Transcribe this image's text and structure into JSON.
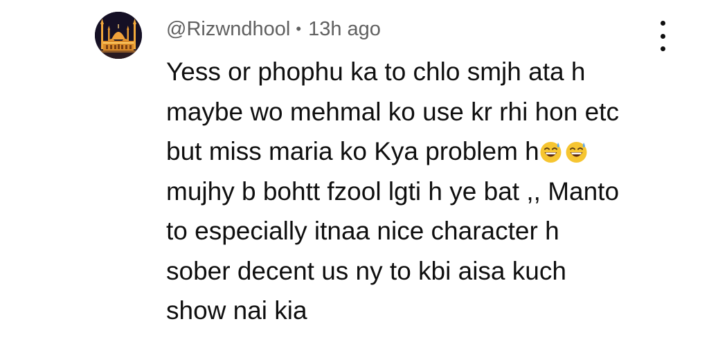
{
  "comment": {
    "author": "@Rizwndhool",
    "separator": "•",
    "time_ago": "13h ago",
    "avatar_icon": "mosque-night-avatar",
    "more_icon": "more-vert-icon",
    "lines": [
      "Yess or phophu ka to chlo smjh ata h",
      "maybe wo mehmal ko use kr rhi hon etc",
      "but miss maria ko Kya problem h",
      "mujhy b bohtt fzool lgti h ye bat ,, Manto",
      "to especially itnaa nice character h",
      "sober decent us ny to kbi aisa kuch",
      "show nai kia"
    ],
    "emojis": [
      "grinning-face-with-sweat",
      "grinning-face-with-sweat"
    ]
  },
  "colors": {
    "text": "#0f0f0f",
    "meta": "#606060",
    "emoji_face": "#f6c531",
    "emoji_sweat": "#5fa8e8"
  }
}
